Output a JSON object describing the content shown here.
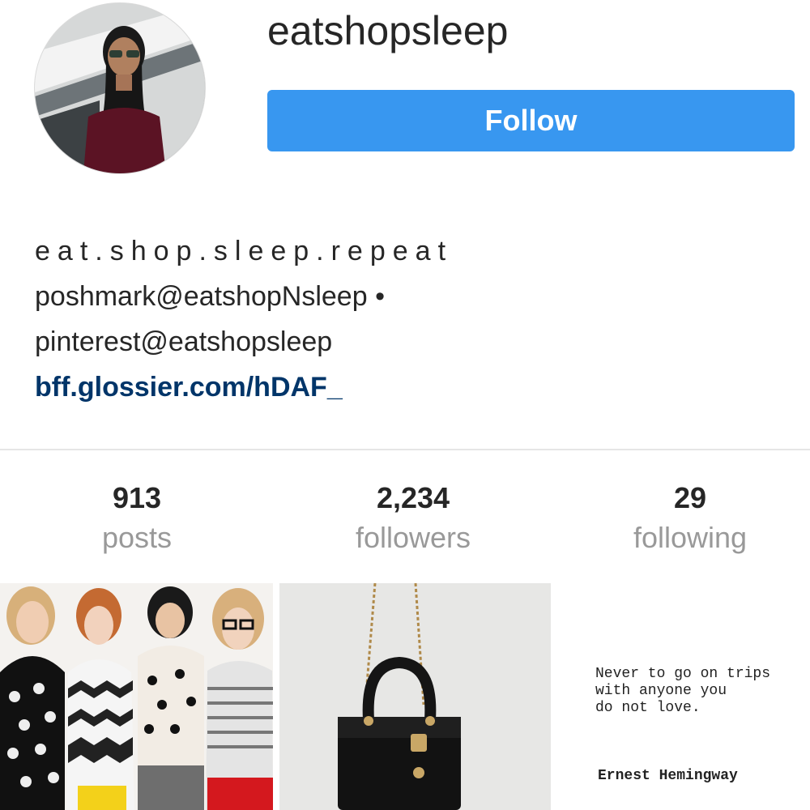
{
  "profile": {
    "username": "eatshopsleep",
    "follow_label": "Follow",
    "bio": {
      "motto": "eat.shop.sleep.repeat",
      "line2": "poshmark@eatshopNsleep •",
      "line3": "pinterest@eatshopsleep",
      "link": "bff.glossier.com/hDAF_"
    }
  },
  "stats": [
    {
      "value": "913",
      "label": "posts"
    },
    {
      "value": "2,234",
      "label": "followers"
    },
    {
      "value": "29",
      "label": "following"
    }
  ],
  "grid": {
    "post3_quote": "Never to go on trips\nwith anyone you\ndo not love.",
    "post3_author": "Ernest Hemingway"
  },
  "colors": {
    "follow_button": "#3897f0",
    "link": "#003569",
    "stat_label": "#999999"
  }
}
